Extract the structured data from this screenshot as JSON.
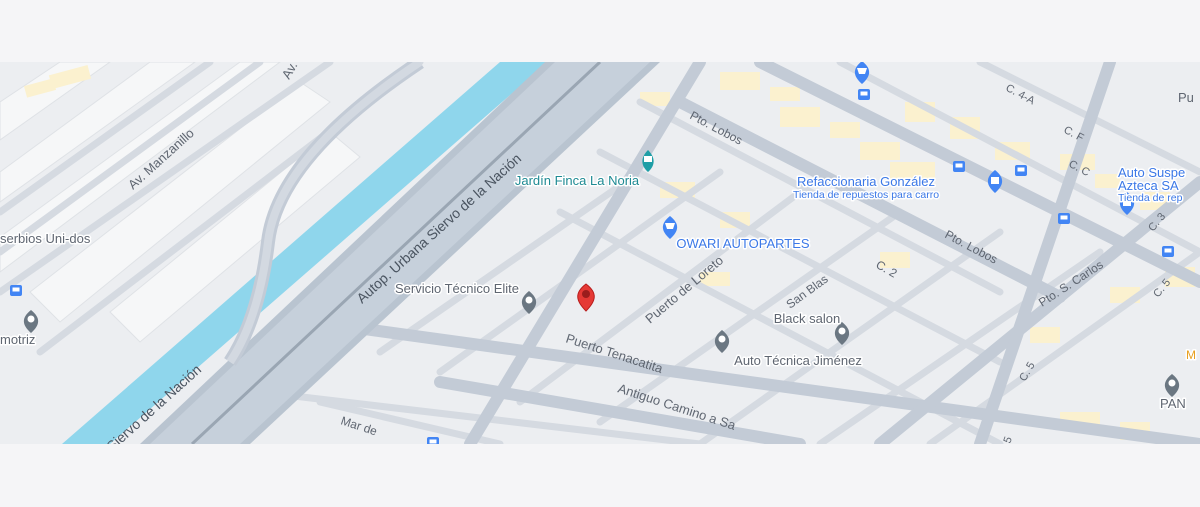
{
  "map": {
    "roads": {
      "highway": "Autop. Urbana Siervo de la Nación",
      "highway_lower": "Siervo de la Nación",
      "av_manzanillo": "Av. Manzanillo",
      "av_top": "Av.",
      "pto_lobos_top": "Pto. Lobos",
      "pto_lobos_mid": "Pto. Lobos",
      "pto_s_carlos": "Pto. S. Carlos",
      "puerto_loreto": "Puerto de Loreto",
      "san_blas": "San Blas",
      "c2": "C. 2",
      "c4a": "C. 4-A",
      "cf": "C. F",
      "cc": "C. C",
      "c3": "C. 3",
      "c5": "C. 5",
      "c5b": "C. 5",
      "puerto_tenacatita": "Puerto Tenacatita",
      "antiguo_camino": "Antiguo Camino a Sa",
      "mar_de": "Mar de",
      "pu": "Pu",
      "five": "5"
    },
    "places": {
      "jardin": "Jardín Finca La Noria",
      "owari": "OWARI AUTOPARTES",
      "refaccionaria": "Refaccionaria González",
      "refaccionaria_sub": "Tienda de repuestos para carro",
      "auto_susp": "Auto Suspe",
      "auto_susp2": "Azteca SA",
      "auto_susp_sub": "Tienda de rep",
      "servicio": "Servicio Técnico Elite",
      "black_salon": "Black salon",
      "auto_tecnica": "Auto Técnica Jiménez",
      "serbios": "serbios Uni-dos",
      "motriz": "motriz",
      "pan": "PAN",
      "m_cut": "M"
    },
    "colors": {
      "water": "#8fd6ec",
      "road": "#c3cbd6",
      "pin": "#e53935",
      "poi_blue": "#4285f4",
      "poi_teal": "#1e9ea6",
      "poi_gray": "#6b7782"
    },
    "icons": {
      "selected": "red-location-pin",
      "park": "park-icon",
      "shopping": "shopping-cart-icon",
      "store": "shopping-bag-icon",
      "place": "gray-place-pin",
      "bus": "bus-stop-icon"
    }
  }
}
